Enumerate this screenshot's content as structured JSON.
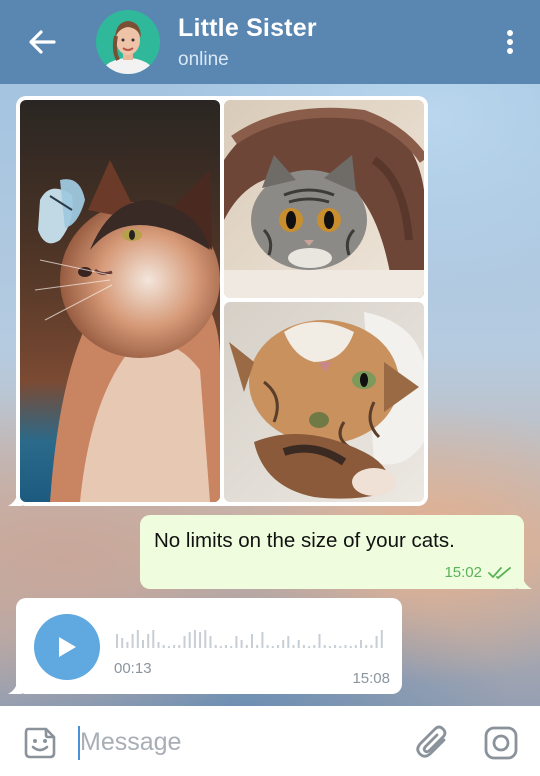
{
  "header": {
    "back_icon": "arrow-left-icon",
    "title": "Little Sister",
    "status": "online",
    "menu_icon": "more-vertical-icon"
  },
  "album": {
    "photos": [
      {
        "subject": "cat with butterfly"
      },
      {
        "subject": "cat under blanket"
      },
      {
        "subject": "cat lying upside down"
      }
    ]
  },
  "messages": {
    "outgoing": {
      "text": "No limits on the size of your cats.",
      "time": "15:02",
      "status_icon": "double-check-icon"
    },
    "voice": {
      "duration": "00:13",
      "time": "15:08",
      "play_icon": "play-icon"
    }
  },
  "input": {
    "placeholder": "Message",
    "sticker_icon": "sticker-icon",
    "attach_icon": "paperclip-icon",
    "camera_icon": "camera-icon"
  },
  "colors": {
    "header": "#5a86b2",
    "outgoing_bubble": "#effdde",
    "check_green": "#5ab35a",
    "play_button": "#5fa8e0"
  }
}
